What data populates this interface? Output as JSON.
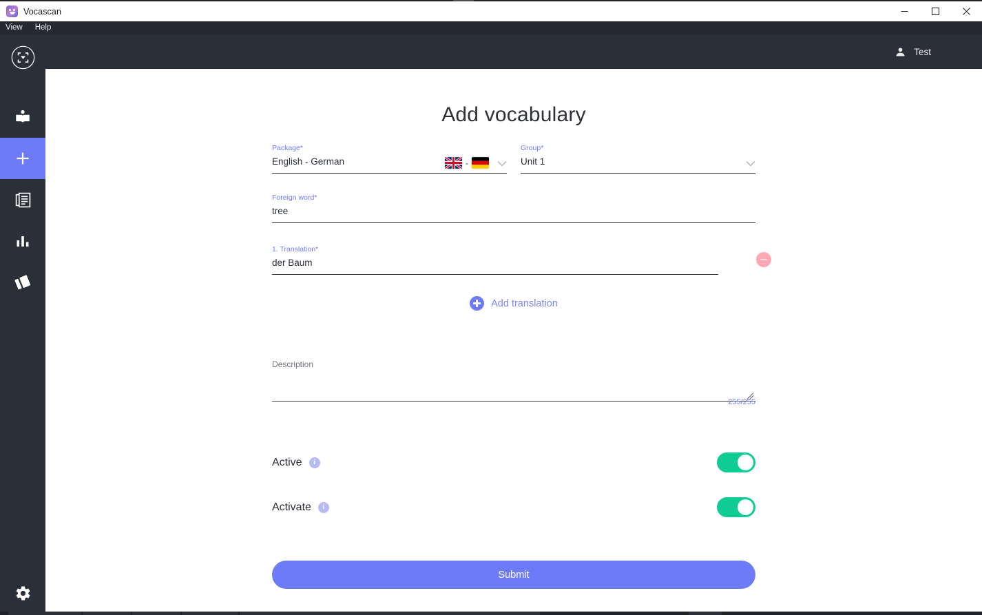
{
  "window": {
    "title": "Vocascan",
    "app_icon": "vocascan-logo-icon",
    "controls": {
      "minimize": "minimize-icon",
      "maximize": "maximize-icon",
      "close": "close-icon"
    }
  },
  "menubar": {
    "items": [
      {
        "label": "View"
      },
      {
        "label": "Help"
      }
    ]
  },
  "header": {
    "user": {
      "name": "Test",
      "icon": "person-icon"
    }
  },
  "sidebar": {
    "logo": "vocascan-scan-logo-icon",
    "items": [
      {
        "id": "learn",
        "icon": "open-book-icon",
        "active": false
      },
      {
        "id": "add",
        "icon": "plus-icon",
        "active": true
      },
      {
        "id": "library",
        "icon": "documents-icon",
        "active": false
      },
      {
        "id": "statistics",
        "icon": "bar-chart-icon",
        "active": false
      },
      {
        "id": "cards",
        "icon": "flashcards-icon",
        "active": false
      }
    ],
    "bottom": {
      "id": "settings",
      "icon": "gear-icon"
    }
  },
  "main": {
    "title": "Add vocabulary",
    "fields": {
      "package": {
        "label": "Package",
        "required_marker": "*",
        "value": "English - German",
        "flag_left": "uk-flag-icon",
        "flag_separator": "-",
        "flag_right": "germany-flag-icon",
        "chevron": "chevron-down-icon"
      },
      "group": {
        "label": "Group",
        "required_marker": "*",
        "value": "Unit 1",
        "chevron": "chevron-down-icon"
      },
      "foreign_word": {
        "label": "Foreign word",
        "required_marker": "*",
        "value": "tree",
        "placeholder": ""
      },
      "translations": [
        {
          "label": "1. Translation",
          "required_marker": "*",
          "value": "der Baum",
          "remove_icon": "minus-circle-icon"
        }
      ],
      "add_translation": {
        "label": "Add translation",
        "icon": "plus-circle-icon"
      },
      "description": {
        "label": "Description",
        "value": "",
        "placeholder": "",
        "char_count": "255/255",
        "resize_handle": "resize-handle-icon"
      }
    },
    "toggles": [
      {
        "id": "active",
        "label": "Active",
        "info_icon": "info-icon",
        "info_glyph": "i",
        "on": true
      },
      {
        "id": "activate",
        "label": "Activate",
        "info_icon": "info-icon",
        "info_glyph": "i",
        "on": true
      }
    ],
    "submit": {
      "label": "Submit"
    }
  },
  "colors": {
    "accent_purple": "#6d7bf7",
    "header_dark": "#2b2f38",
    "menubar_dark": "#26292f",
    "toggle_green": "#0fcc92",
    "remove_pink": "#ffa8b4",
    "info_lavender": "#b6bcf3"
  }
}
